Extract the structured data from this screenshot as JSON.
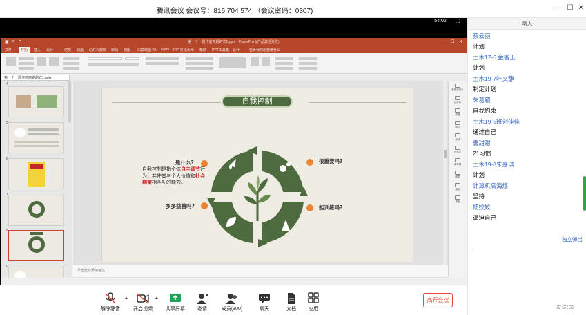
{
  "window": {
    "title": "腾讯会议 会议号：816 704 574 （会议密码：0307)",
    "minimize": "—",
    "maximize": "☐",
    "close": "✕"
  },
  "share": {
    "timer": "54:02",
    "fullscreen_icon": "fullscreen-icon"
  },
  "ppt": {
    "title": "第一个一题作前两期的式1.pptx - PowerPoint(产品激活失败)",
    "tabs": [
      "文件",
      "开始",
      "插入",
      "设计",
      "切换",
      "动画",
      "幻灯片放映",
      "审阅",
      "视图",
      "口袋动画 PA",
      "iSlide",
      "PPT美化大师",
      "帮助",
      "PPT工具箱",
      "设计",
      "告诉我你想要做什么"
    ],
    "active_tab": "开始",
    "doc_tab": "第一个一题作前两期的式1.pptx",
    "notes_placeholder": "单击此处添加备注",
    "thumb_numbers": [
      "4",
      "5",
      "6",
      "7",
      "8",
      "9"
    ],
    "right_pane": [
      "新建幻灯片",
      "幻灯片",
      "表格",
      "图片",
      "形状",
      "艺术字",
      "文本框",
      "图表",
      "组合",
      "更多"
    ]
  },
  "slide": {
    "title": "自我控制",
    "q_top_left": "是什么?",
    "q_top_right": "很重要吗?",
    "q_bottom_left": "多多益善吗?",
    "q_bottom_right": "能训练吗?",
    "desc_1": "自我控制是指个体",
    "desc_red_1": "自主调节",
    "desc_2": "行为，并使其与个人价值和",
    "desc_red_2": "社会期望",
    "desc_3": "相匹配的能力。"
  },
  "toolbar": {
    "mute": "解除静音",
    "video": "开启视频",
    "share_screen": "共享屏幕",
    "invite": "邀请",
    "members": "成员(300)",
    "chat": "聊天",
    "docs": "文档",
    "apps": "应用",
    "leave": "离开会议"
  },
  "chat": {
    "header": "聊天",
    "messages": [
      {
        "name": "蔡云丽",
        "text": "计划"
      },
      {
        "name": "土木17-6 金香玉",
        "text": "计划"
      },
      {
        "name": "土木19-7叶文静",
        "text": "制定计划"
      },
      {
        "name": "朱葛颖",
        "text": "自我约束"
      },
      {
        "name": "土木19-5班刘佳佳",
        "text": "通过自己"
      },
      {
        "name": "曹甜甜",
        "text": "21习惯"
      },
      {
        "name": "土木19-8朱嘉琪",
        "text": "计划"
      },
      {
        "name": "计算机高海炼",
        "text": "坚持"
      },
      {
        "name": "杨姣姣",
        "text": "逼迫自己"
      }
    ],
    "private_label": "独立弹出",
    "send_label": "发送(S)"
  },
  "colors": {
    "ppt_red": "#b7472a",
    "slide_green": "#4e6a3f",
    "accent_orange": "#ea8434",
    "chat_blue": "#3d68c4",
    "leave_red": "#e8473b"
  }
}
